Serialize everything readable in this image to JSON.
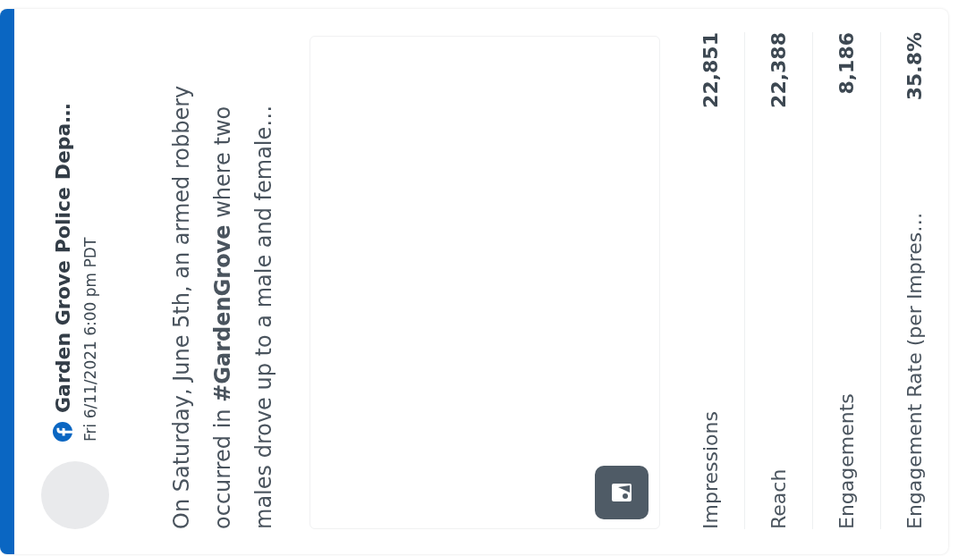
{
  "post": {
    "author": "Garden Grove Police Depa…",
    "timestamp": "Fri 6/11/2021 6:00 pm PDT",
    "text": "On Saturday, June 5th, an armed robbery occurred in **#GardenGrove** where two males drove up to a male and female…"
  },
  "metrics": [
    {
      "label": "Impressions",
      "value": "22,851"
    },
    {
      "label": "Reach",
      "value": "22,388"
    },
    {
      "label": "Engagements",
      "value": "8,186"
    },
    {
      "label": "Engagement Rate (per Impres…",
      "value": "35.8%"
    }
  ]
}
